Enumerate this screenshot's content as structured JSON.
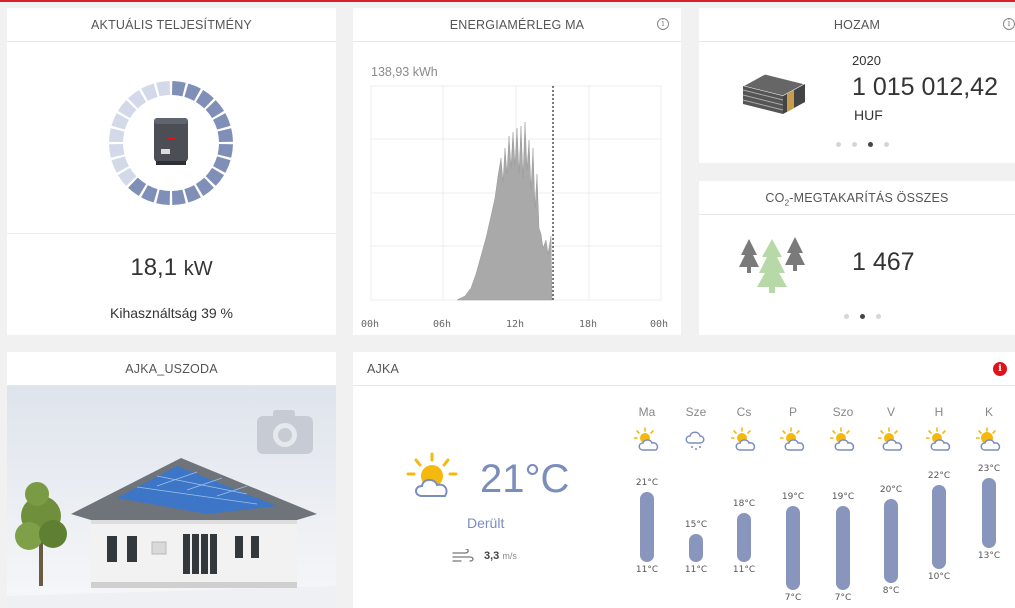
{
  "power_card": {
    "title": "AKTUÁLIS TELJESÍTMÉNY",
    "value": "18,1",
    "unit": "kW",
    "usage_text": "Kihasználtság 39 %",
    "gauge_fraction": 0.39
  },
  "energy_card": {
    "title": "ENERGIAMÉRLEG MA",
    "total": "138,93 kWh",
    "x_labels": [
      "00h",
      "06h",
      "12h",
      "18h",
      "00h"
    ]
  },
  "yield_card": {
    "title": "HOZAM",
    "year": "2020",
    "amount": "1 015 012,42",
    "currency": "HUF"
  },
  "co2_card": {
    "title_prefix": "CO",
    "title_sub": "2",
    "title_suffix": "-MEGTAKARÍTÁS ÖSSZES",
    "value": "1 467"
  },
  "system_card": {
    "title": "AJKA_USZODA"
  },
  "weather_card": {
    "title": "AJKA",
    "current_temp": "21°C",
    "condition": "Derült",
    "wind_value": "3,3",
    "wind_unit": "m/s",
    "days": [
      {
        "name": "Ma",
        "high": "21°C",
        "low": "11°C",
        "hi": 21,
        "lo": 11,
        "icon": "partly-cloudy-icon"
      },
      {
        "name": "Sze",
        "high": "15°C",
        "low": "11°C",
        "hi": 15,
        "lo": 11,
        "icon": "rain-cloud-icon"
      },
      {
        "name": "Cs",
        "high": "18°C",
        "low": "11°C",
        "hi": 18,
        "lo": 11,
        "icon": "partly-cloudy-icon"
      },
      {
        "name": "P",
        "high": "19°C",
        "low": "7°C",
        "hi": 19,
        "lo": 7,
        "icon": "partly-cloudy-icon"
      },
      {
        "name": "Szo",
        "high": "19°C",
        "low": "7°C",
        "hi": 19,
        "lo": 7,
        "icon": "partly-cloudy-icon"
      },
      {
        "name": "V",
        "high": "20°C",
        "low": "8°C",
        "hi": 20,
        "lo": 8,
        "icon": "partly-cloudy-icon"
      },
      {
        "name": "H",
        "high": "22°C",
        "low": "10°C",
        "hi": 22,
        "lo": 10,
        "icon": "partly-cloudy-icon"
      },
      {
        "name": "K",
        "high": "23°C",
        "low": "13°C",
        "hi": 23,
        "lo": 13,
        "icon": "sunny-cloud-icon"
      }
    ]
  },
  "colors": {
    "accent_red": "#d9202a",
    "gauge_blue": "#7f8fb8",
    "gauge_light": "#d3d9e8",
    "weather_blue": "#7b8dbb"
  }
}
